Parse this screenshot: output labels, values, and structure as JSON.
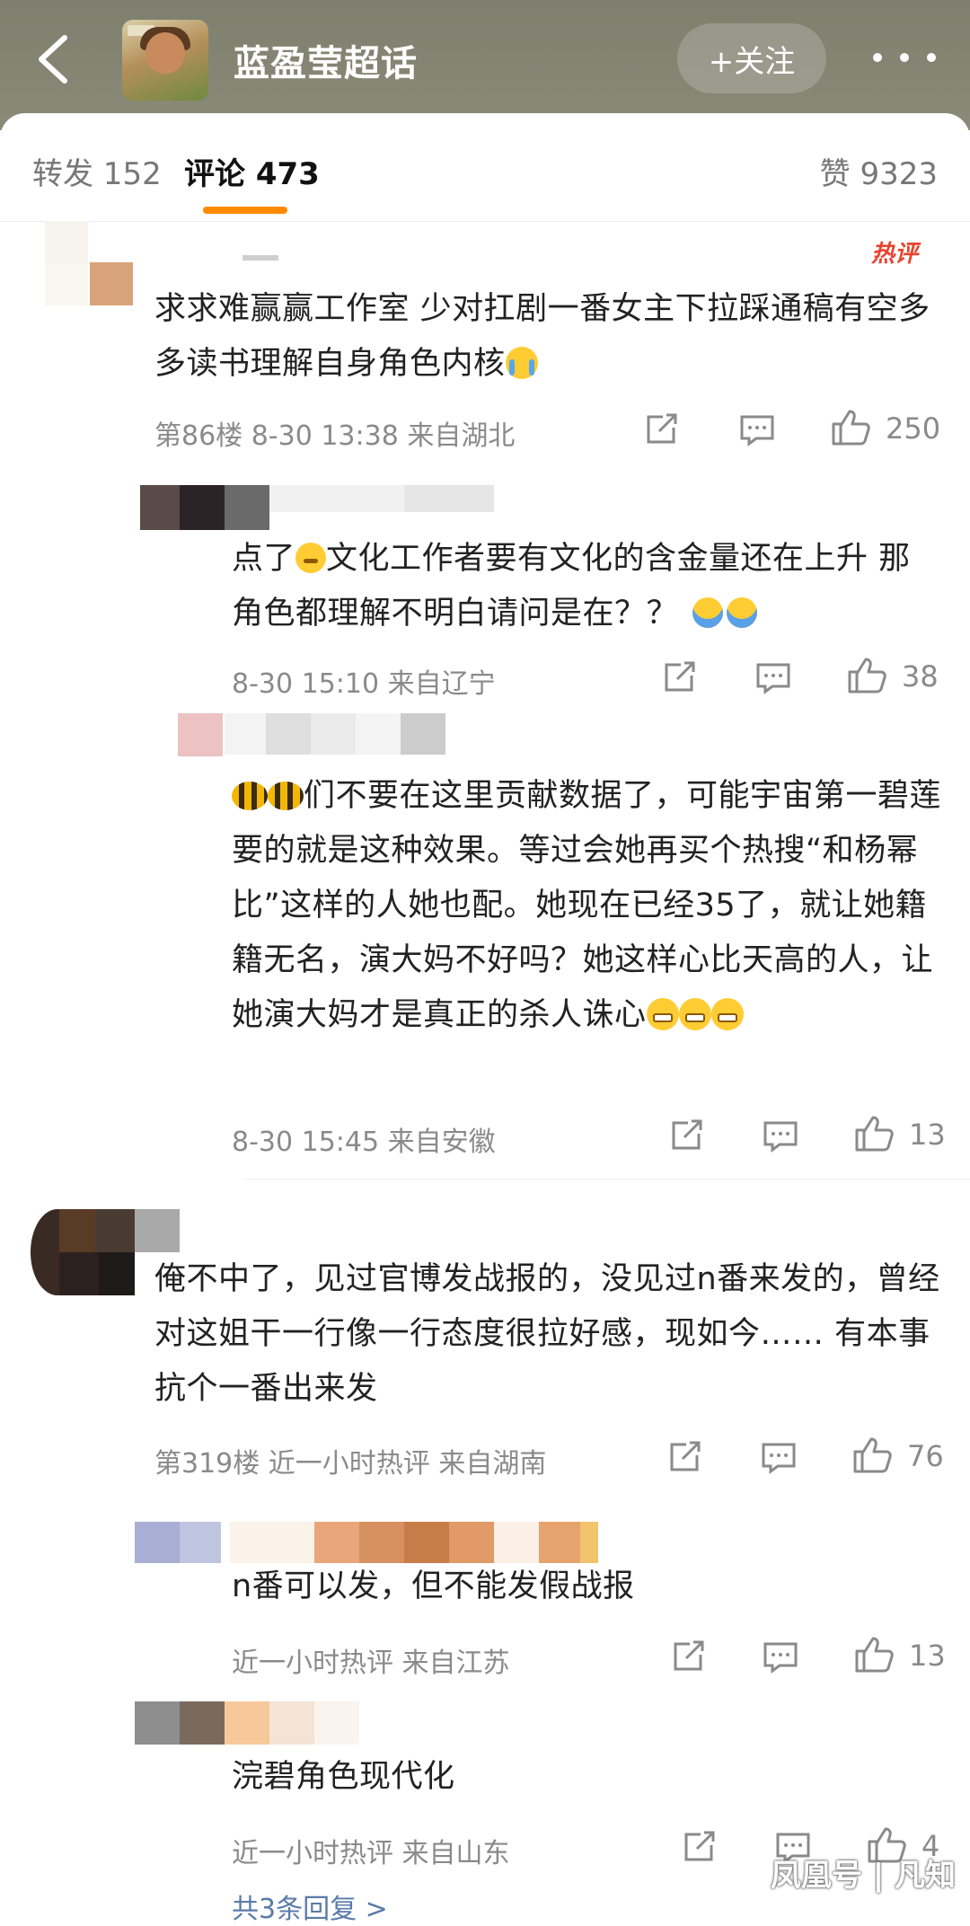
{
  "header": {
    "title": "蓝盈莹超话",
    "follow_label": "+关注"
  },
  "tabs": {
    "repost": "转发 152",
    "comments": "评论 473",
    "likes": "赞 9323"
  },
  "hot_badge": "热评",
  "comments": [
    {
      "text": "求求难赢赢工作室 少对扛剧一番女主下拉踩通稿有空多多读书理解自身角色内核",
      "meta": "第86楼 8-30 13:38 来自湖北",
      "likes": "250"
    },
    {
      "text_before": "点了",
      "text_after": "文化工作者要有文化的含金量还在上升 那角色都理解不明白请问是在？？",
      "meta": "8-30 15:10 来自辽宁",
      "likes": "38"
    },
    {
      "text": "们不要在这里贡献数据了，可能宇宙第一碧莲要的就是这种效果。等过会她再买个热搜“和杨幂比”这样的人她也配。她现在已经35了，就让她籍籍无名，演大妈不好吗？她这样心比天高的人，让她演大妈才是真正的杀人诛心",
      "meta": "8-30 15:45 来自安徽",
      "likes": "13"
    },
    {
      "text": "俺不中了，见过官博发战报的，没见过n番来发的，曾经对这姐干一行像一行态度很拉好感，现如今…… 有本事抗个一番出来发",
      "meta": "第319楼 近一小时热评 来自湖南",
      "likes": "76"
    },
    {
      "text": "n番可以发，但不能发假战报",
      "meta": "近一小时热评 来自江苏",
      "likes": "13"
    },
    {
      "text": "浣碧角色现代化",
      "meta": "近一小时热评 来自山东",
      "likes": "4"
    }
  ],
  "more_replies": "共3条回复 >",
  "watermark": "凤凰号 | 凡知",
  "colors": {
    "accent": "#ff8a00",
    "hot": "#e8432f",
    "header_bg": "#8a8a78"
  }
}
